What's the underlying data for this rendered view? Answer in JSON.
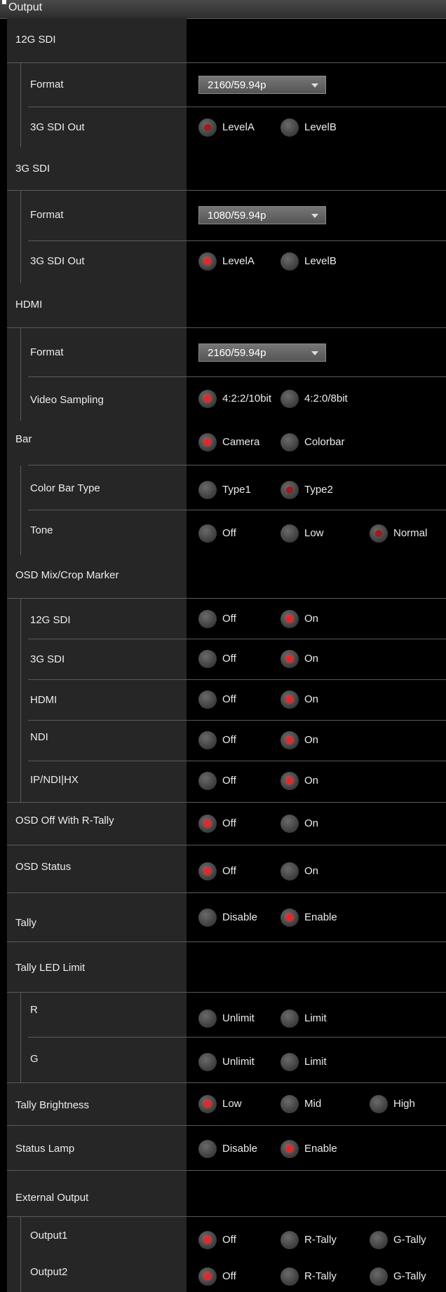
{
  "header": {
    "title": "Output"
  },
  "sections": {
    "sdi12g": {
      "label": "12G SDI",
      "format_label": "Format",
      "format_value": "2160/59.94p",
      "out_label": "3G SDI Out",
      "levelA": "LevelA",
      "levelB": "LevelB"
    },
    "sdi3g": {
      "label": "3G SDI",
      "format_label": "Format",
      "format_value": "1080/59.94p",
      "out_label": "3G SDI Out",
      "levelA": "LevelA",
      "levelB": "LevelB"
    },
    "hdmi": {
      "label": "HDMI",
      "format_label": "Format",
      "format_value": "2160/59.94p",
      "sampling_label": "Video Sampling",
      "opt1": "4:2:2/10bit",
      "opt2": "4:2:0/8bit"
    },
    "bar": {
      "label": "Bar",
      "opt1": "Camera",
      "opt2": "Colorbar",
      "type_label": "Color Bar Type",
      "type1": "Type1",
      "type2": "Type2",
      "tone_label": "Tone",
      "tone_off": "Off",
      "tone_low": "Low",
      "tone_normal": "Normal"
    },
    "osd_mix": {
      "label": "OSD Mix/Crop Marker",
      "items": [
        "12G SDI",
        "3G SDI",
        "HDMI",
        "NDI",
        "IP/NDI|HX"
      ],
      "off": "Off",
      "on": "On"
    },
    "osd_rtally": {
      "label": "OSD Off With R-Tally",
      "off": "Off",
      "on": "On"
    },
    "osd_status": {
      "label": "OSD Status",
      "off": "Off",
      "on": "On"
    },
    "tally": {
      "label": "Tally",
      "disable": "Disable",
      "enable": "Enable"
    },
    "tally_led": {
      "label": "Tally LED Limit",
      "r_label": "R",
      "g_label": "G",
      "unlimit": "Unlimit",
      "limit": "Limit"
    },
    "tally_brightness": {
      "label": "Tally Brightness",
      "low": "Low",
      "mid": "Mid",
      "high": "High"
    },
    "status_lamp": {
      "label": "Status Lamp",
      "disable": "Disable",
      "enable": "Enable"
    },
    "external_output": {
      "label": "External Output",
      "out1_label": "Output1",
      "out2_label": "Output2",
      "off": "Off",
      "rtally": "R-Tally",
      "gtally": "G-Tally"
    }
  },
  "colors": {
    "accent": "#e8262a",
    "panel": "#262626",
    "background": "#000000",
    "divider": "#5a5a5a"
  },
  "icons": {
    "radio": "radio-button-icon",
    "dropdown": "chevron-down-icon"
  }
}
